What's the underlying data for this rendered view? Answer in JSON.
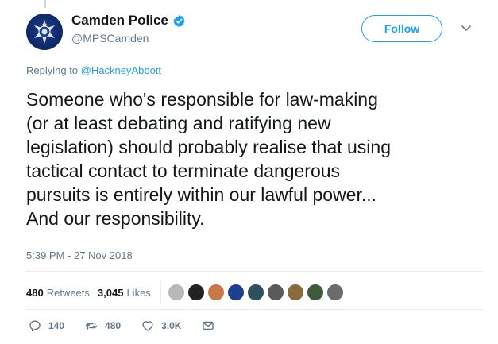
{
  "account": {
    "display_name": "Camden Police",
    "handle": "@MPSCamden",
    "verified": true
  },
  "follow_label": "Follow",
  "reply": {
    "prefix": "Replying to",
    "to": "@HackneyAbbott"
  },
  "tweet_text": "Someone who's responsible for law-making\n(or at least debating and ratifying new\nlegislation) should probably realise that using\ntactical contact to terminate dangerous\npursuits is entirely within our lawful power...\nAnd our responsibility.",
  "timestamp": "5:39 PM - 27 Nov 2018",
  "stats": {
    "retweets_count": "480",
    "retweets_label": "Retweets",
    "likes_count": "3,045",
    "likes_label": "Likes"
  },
  "likers": [
    {
      "icon": "avatar-1",
      "color": "#b8b8b8"
    },
    {
      "icon": "avatar-2",
      "color": "#222222"
    },
    {
      "icon": "avatar-3",
      "color": "#c7794a"
    },
    {
      "icon": "avatar-4",
      "color": "#1c3f8e"
    },
    {
      "icon": "avatar-5",
      "color": "#2f4f5f"
    },
    {
      "icon": "avatar-6",
      "color": "#5a5a5a"
    },
    {
      "icon": "avatar-7",
      "color": "#8a6a3a"
    },
    {
      "icon": "avatar-8",
      "color": "#3d5a3d"
    },
    {
      "icon": "avatar-9",
      "color": "#6b6b6b"
    }
  ],
  "actions": {
    "replies": "140",
    "retweets": "480",
    "likes": "3.0K"
  },
  "colors": {
    "accent": "#1da1f2",
    "text": "#14171a",
    "muted": "#657786"
  }
}
